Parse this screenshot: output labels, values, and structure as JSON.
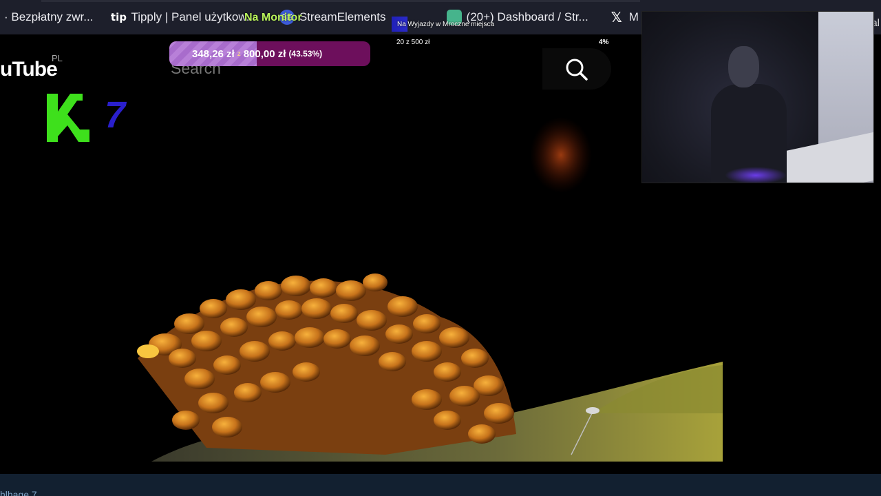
{
  "bookmarks": {
    "items": [
      {
        "label": "· Bezpłatny zwr...",
        "icon": ""
      },
      {
        "label": "Tipply | Panel użytkow...",
        "icon": "tipply-icon",
        "glyph": "tip"
      },
      {
        "label": "StreamElements",
        "icon": "streamelements-icon",
        "glyph": "SE"
      },
      {
        "label": "(20+) Dashboard / Str...",
        "icon": "dashboard-icon",
        "glyph": ""
      },
      {
        "label": "M",
        "icon": "x-icon",
        "glyph": "𝕏"
      }
    ],
    "tail": "al"
  },
  "overlay": {
    "na_monitor": "Na Monitor",
    "goal_tag": "Na Wyjazdy w Mroczne miejsca",
    "goal_current": "348,26 zł",
    "goal_sep": "z",
    "goal_total": "800,00 zł",
    "goal_percent_label": "(43.53%)",
    "goal_progress": 0.4353,
    "alt_goal": "20 z 500 zł",
    "alt_percent": "4%"
  },
  "youtube": {
    "logo": "uTube",
    "region": "PL",
    "search_placeholder": "Search"
  },
  "k7": {
    "digit": "7"
  },
  "bottom": {
    "text": "hlhage 7"
  },
  "colors": {
    "bookmarks_bg": "#1d1f2b",
    "goal_bg": "#6d0f5c",
    "goal_fill": "#b880d8",
    "na_monitor": "#b8f25a",
    "k_green": "#3ee01c",
    "seven_blue": "#2a1fcc",
    "bottom_bar": "#122030"
  }
}
